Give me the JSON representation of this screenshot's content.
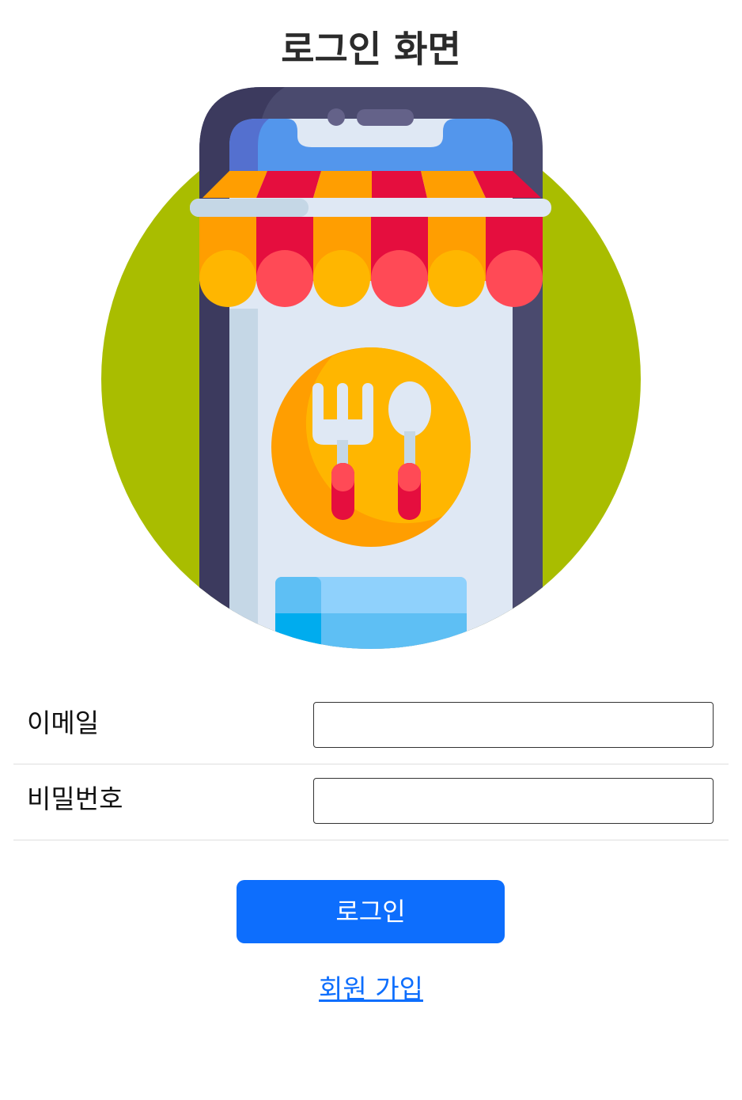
{
  "page": {
    "title": "로그인 화면"
  },
  "hero": {
    "icon": "restaurant-app-icon",
    "colors": {
      "circle": "#a9bd00",
      "phone_frame": "#4a4a6e",
      "screen_top": "#5396ec",
      "screen_body": "#dfe8f4",
      "awning_orange": "#ff9e01",
      "awning_red": "#e50e3e",
      "plate": "#ffb600",
      "utensil_handle": "#ff4a56"
    }
  },
  "form": {
    "email_label": "이메일",
    "email_value": "",
    "password_label": "비밀번호",
    "password_value": ""
  },
  "actions": {
    "login_label": "로그인",
    "signup_label": "회원 가입"
  },
  "theme": {
    "accent": "#0d6efd"
  }
}
